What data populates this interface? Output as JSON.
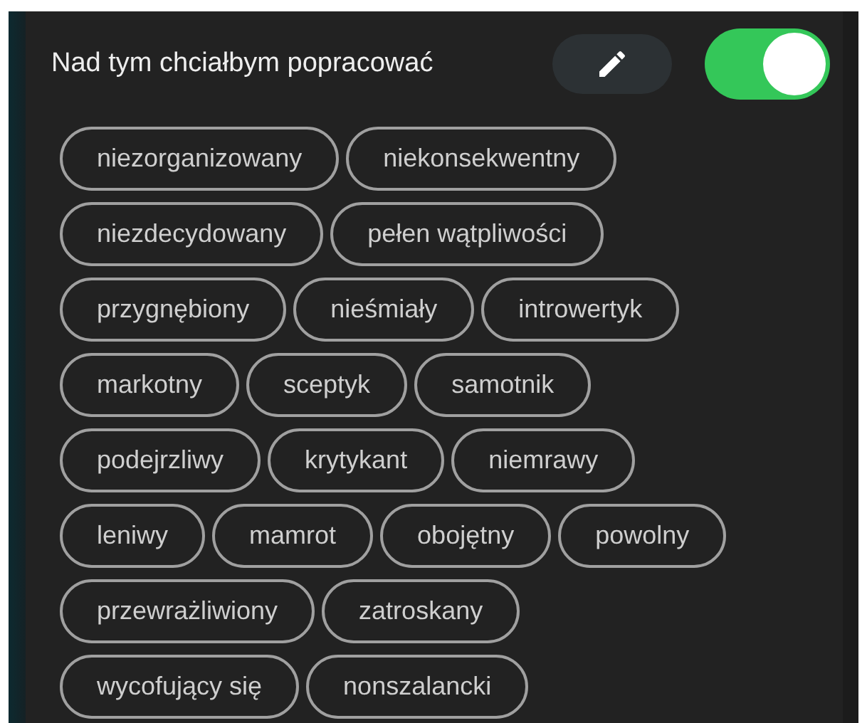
{
  "header": {
    "title": "Nad tym chciałbym popracować",
    "toggle": {
      "on": true
    }
  },
  "tag_rows": [
    [
      "niezorganizowany",
      "niekonsekwentny"
    ],
    [
      "niezdecydowany",
      "pełen wątpliwości"
    ],
    [
      "przygnębiony",
      "nieśmiały",
      "introwertyk"
    ],
    [
      "markotny",
      "sceptyk",
      "samotnik"
    ],
    [
      "podejrzliwy",
      "krytykant",
      "niemrawy"
    ],
    [
      "leniwy",
      "mamrot",
      "obojętny",
      "powolny"
    ],
    [
      "przewrażliwiony",
      "zatroskany"
    ],
    [
      "wycofujący się",
      "nonszalancki"
    ]
  ]
}
